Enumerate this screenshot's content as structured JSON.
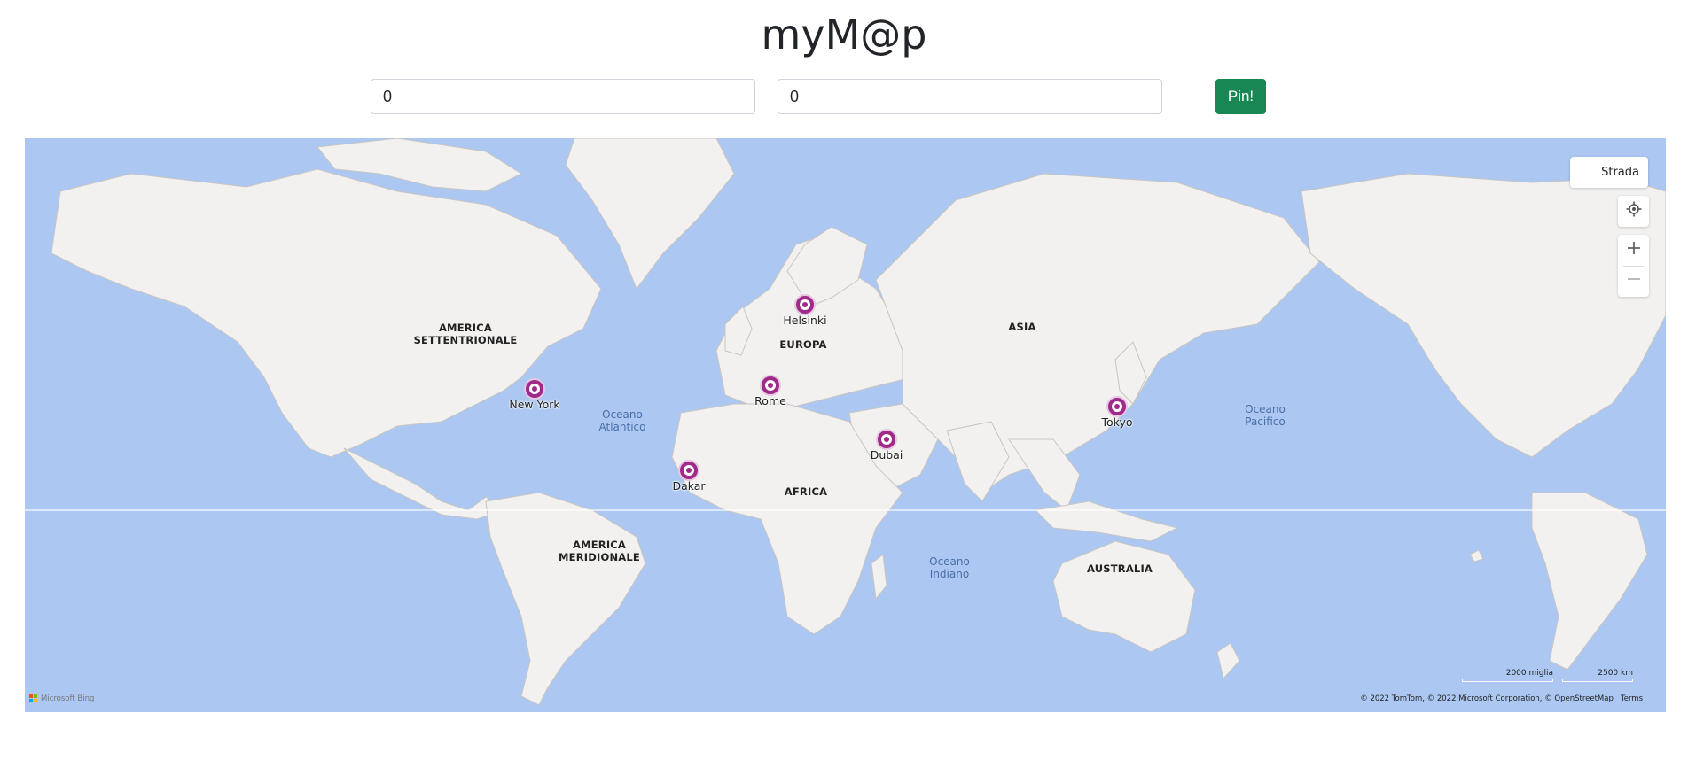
{
  "header": {
    "title": "myM@p"
  },
  "form": {
    "latitude_value": "0",
    "longitude_value": "0",
    "pin_label": "Pin!"
  },
  "map": {
    "style_label": "Strada",
    "continents": [
      "AMERICA\nSETTENTRIONALE",
      "EUROPA",
      "ASIA",
      "AFRICA",
      "AMERICA\nMERIDIONALE",
      "AUSTRALIA"
    ],
    "oceans": [
      "Oceano\nAtlantico",
      "Oceano\nPacifico",
      "Oceano\nIndiano"
    ],
    "pins": [
      {
        "name": "Helsinki"
      },
      {
        "name": "New York"
      },
      {
        "name": "Rome"
      },
      {
        "name": "Tokyo"
      },
      {
        "name": "Dubai"
      },
      {
        "name": "Dakar"
      }
    ],
    "scale_miles": "2000 miglia",
    "scale_km": "2500 km",
    "copyright_text": "© 2022 TomTom, © 2022 Microsoft Corporation,",
    "osm_link": "© OpenStreetMap",
    "terms_link": "Terms",
    "logo_text": "Microsoft Bing",
    "pin_color": "#a02a8a",
    "water_color": "#abc7f2",
    "land_color": "#f2f1ef",
    "button_color": "#198754"
  }
}
